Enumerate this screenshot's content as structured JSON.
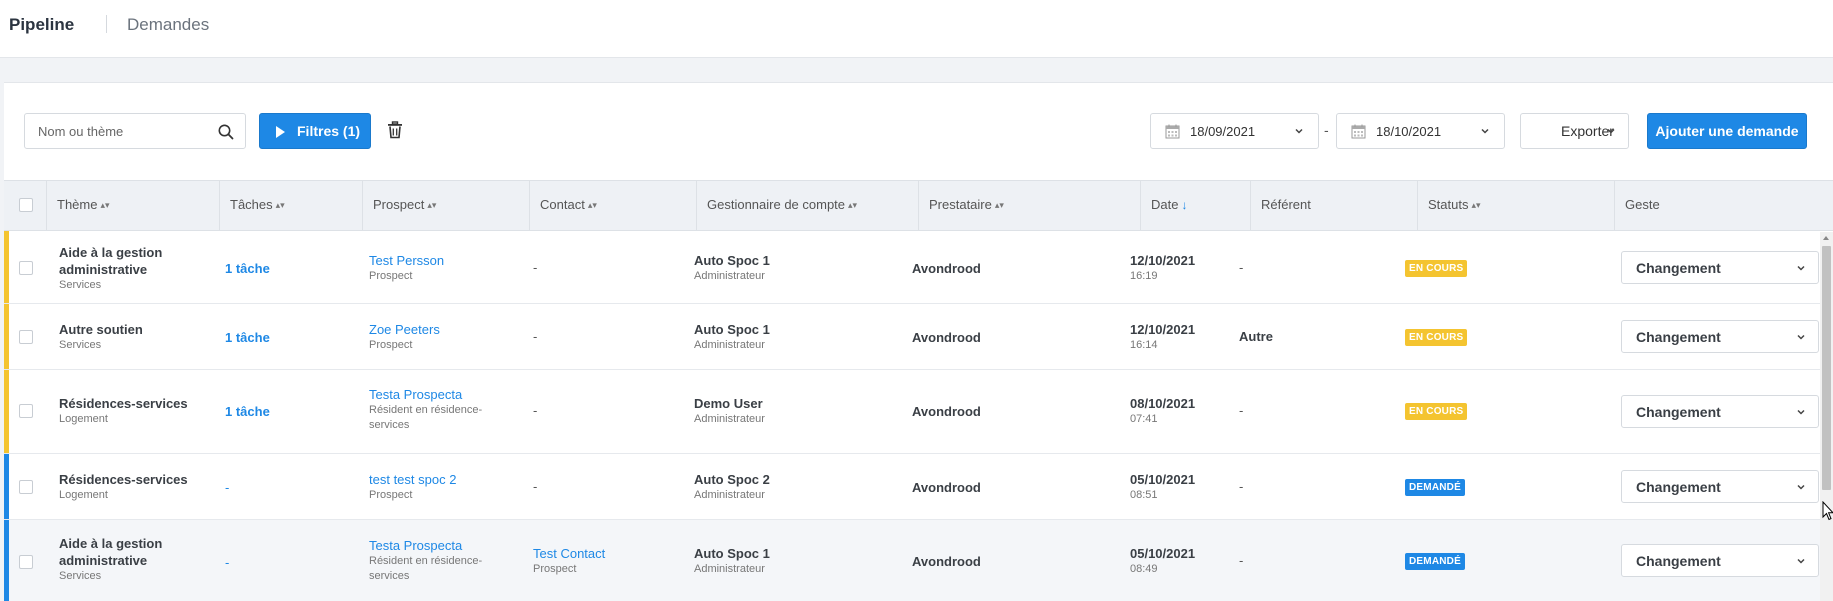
{
  "topbar": {
    "title": "Pipeline",
    "breadcrumb": "Demandes"
  },
  "toolbar": {
    "search_placeholder": "Nom ou thème",
    "filters_label": "Filtres (1)",
    "date_from": "18/09/2021",
    "date_separator": "-",
    "date_to": "18/10/2021",
    "export_label": "Exporter",
    "add_label": "Ajouter une demande"
  },
  "table": {
    "headers": {
      "theme": "Thème",
      "taches": "Tâches",
      "prospect": "Prospect",
      "contact": "Contact",
      "gestionnaire": "Gestionnaire de compte",
      "prestataire": "Prestataire",
      "date": "Date",
      "referent": "Référent",
      "statuts": "Statuts",
      "geste": "Geste"
    },
    "rows": [
      {
        "status_color": "#f4c430",
        "theme": "Aide à la gestion administrative",
        "theme_l1": "Aide à la gestion",
        "theme_l2": "administrative",
        "category": "Services",
        "taches": "1 tâche",
        "prospect": "Test Persson",
        "prospect_l2": "",
        "prospect_type": "Prospect",
        "contact": "-",
        "contact_type": "",
        "gestionnaire": "Auto Spoc 1",
        "role": "Administrateur",
        "prestataire": "Avondrood",
        "date": "12/10/2021",
        "time": "16:19",
        "referent": "-",
        "statut": "EN COURS",
        "geste": "Changement"
      },
      {
        "status_color": "#f4c430",
        "theme": "Autre soutien",
        "theme_l1": "Autre soutien",
        "theme_l2": "",
        "category": "Services",
        "taches": "1 tâche",
        "prospect": "Zoe Peeters",
        "prospect_l2": "",
        "prospect_type": "Prospect",
        "contact": "-",
        "contact_type": "",
        "gestionnaire": "Auto Spoc 1",
        "role": "Administrateur",
        "prestataire": "Avondrood",
        "date": "12/10/2021",
        "time": "16:14",
        "referent": "Autre",
        "statut": "EN COURS",
        "geste": "Changement"
      },
      {
        "status_color": "#f4c430",
        "theme": "Résidences-services",
        "theme_l1": "Résidences-services",
        "theme_l2": "",
        "category": "Logement",
        "taches": "1 tâche",
        "prospect": "Testa Prospecta",
        "prospect_l2": "services",
        "prospect_type": "Résident en résidence-",
        "contact": "-",
        "contact_type": "",
        "gestionnaire": "Demo User",
        "role": "Administrateur",
        "prestataire": "Avondrood",
        "date": "08/10/2021",
        "time": "07:41",
        "referent": "-",
        "statut": "EN COURS",
        "geste": "Changement"
      },
      {
        "status_color": "#1e88e5",
        "theme": "Résidences-services",
        "theme_l1": "Résidences-services",
        "theme_l2": "",
        "category": "Logement",
        "taches": "-",
        "prospect": "test test spoc 2",
        "prospect_l2": "",
        "prospect_type": "Prospect",
        "contact": "-",
        "contact_type": "",
        "gestionnaire": "Auto Spoc 2",
        "role": "Administrateur",
        "prestataire": "Avondrood",
        "date": "05/10/2021",
        "time": "08:51",
        "referent": "-",
        "statut": "DEMANDÉ",
        "geste": "Changement"
      },
      {
        "status_color": "#1e88e5",
        "theme": "Aide à la gestion administrative",
        "theme_l1": "Aide à la gestion",
        "theme_l2": "administrative",
        "category": "Services",
        "taches": "-",
        "prospect": "Testa Prospecta",
        "prospect_l2": "services",
        "prospect_type": "Résident en résidence-",
        "contact": "Test Contact",
        "contact_type": "Prospect",
        "gestionnaire": "Auto Spoc 1",
        "role": "Administrateur",
        "prestataire": "Avondrood",
        "date": "05/10/2021",
        "time": "08:49",
        "referent": "-",
        "statut": "DEMANDÉ",
        "geste": "Changement"
      }
    ]
  }
}
